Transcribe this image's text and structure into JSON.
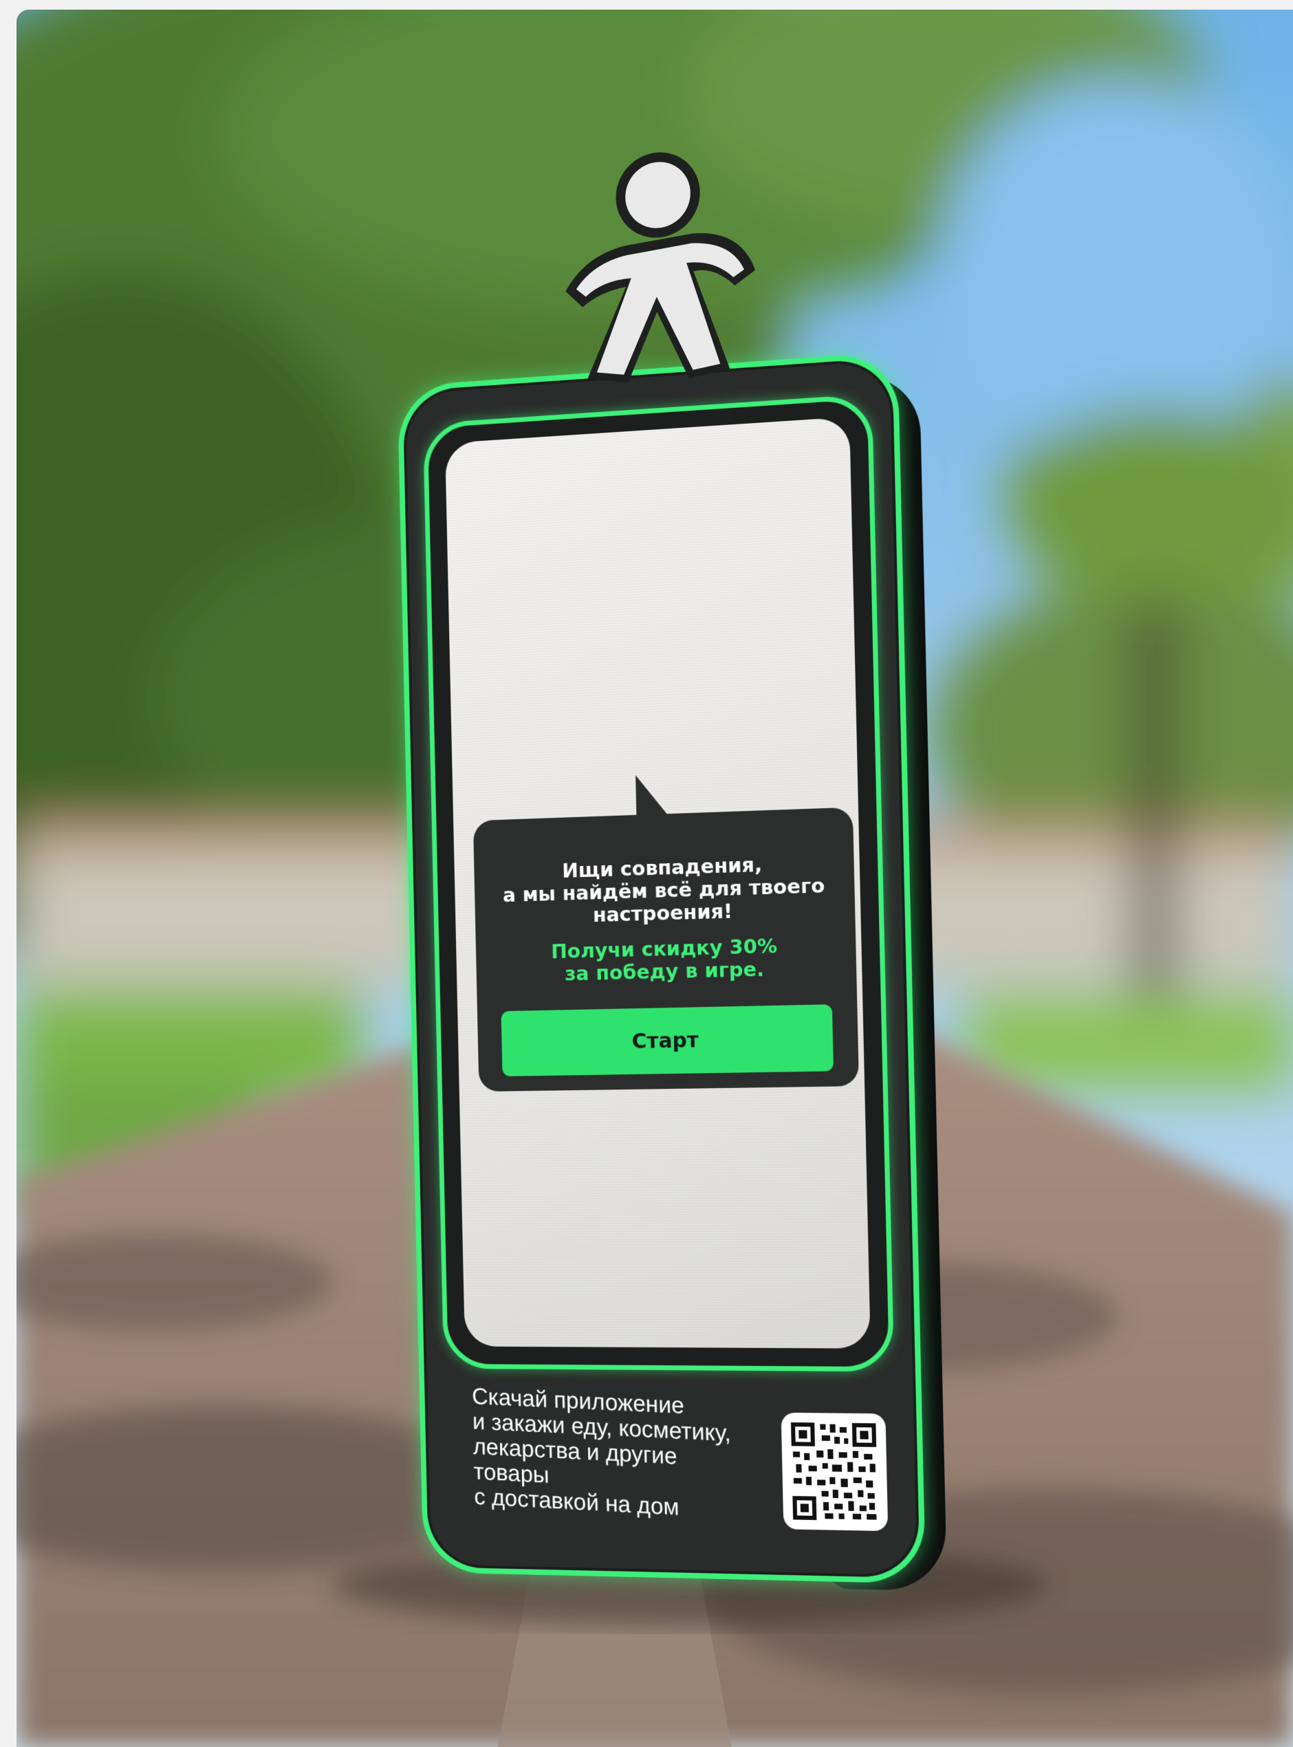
{
  "poster": {
    "bubble_heading": "Ищи совпадения,\nа мы найдём всё для твоего\nнастроения!",
    "bubble_promo": "Получи скидку 30%\nза победу в игре.",
    "start_label": "Старт",
    "bottom_caption": "Скачай приложение\nи закажи еду, косметику,\nлекарства и другие товары\nс доставкой на дом"
  },
  "colors": {
    "accent_green": "#3ef07a",
    "kiosk_dark": "#2a2c2b",
    "screen_white": "#efeeec"
  },
  "icons": {
    "mascot": "walking-person-icon",
    "qr": "qr-code-icon"
  }
}
